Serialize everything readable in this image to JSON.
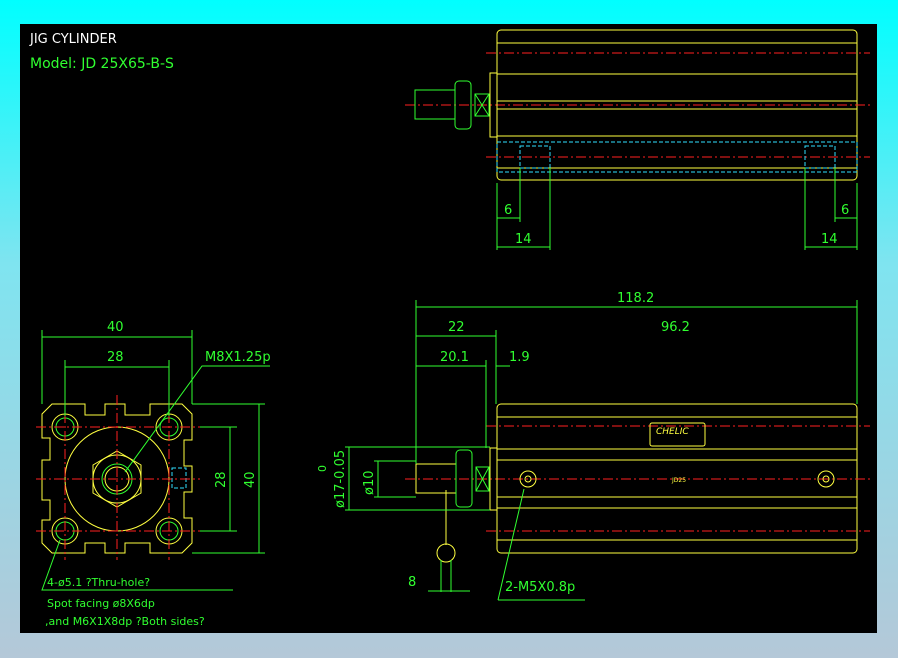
{
  "title": "JIG CYLINDER",
  "model": "Model:  JD 25X65-B-S",
  "colors": {
    "outline": "#ffff40",
    "dimension": "#30ff30",
    "centerline": "#ff2020",
    "hidden": "#30e0ff",
    "background": "#000000"
  },
  "top_view": {
    "dims": {
      "left_6": "6",
      "left_14": "14",
      "right_6": "6",
      "right_14": "14"
    }
  },
  "side_view": {
    "dims": {
      "overall": "118.2",
      "rod_length": "22",
      "body_length": "96.2",
      "rod_thread": "20.1",
      "collar": "1.9",
      "bore_dia": "ø17-0.05",
      "bore_tol_upper": "0",
      "rod_dia": "ø10",
      "wrench": "8"
    },
    "port_note": "2-M5X0.8p",
    "label_brand": "CHELIC",
    "body_mark": "JD25"
  },
  "end_view": {
    "dims": {
      "width": "40",
      "hole_pitch_x": "28",
      "hole_pitch_y": "28",
      "height": "40"
    },
    "thread_note": "M8X1.25p",
    "hole_note_1": "4-ø5.1 ?Thru-hole?",
    "hole_note_2": "Spot facing  ø8X6dp",
    "hole_note_3": ",and M6X1X8dp ?Both sides?"
  }
}
